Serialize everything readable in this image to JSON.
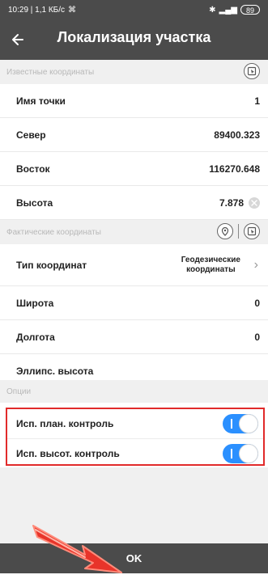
{
  "status_bar": {
    "time_info": "10:29 | 1,1 КБ/с",
    "battery": "89"
  },
  "header": {
    "title": "Локализация участка"
  },
  "sections": {
    "known": "Известные координаты",
    "actual": "Фактические координаты",
    "options": "Опции"
  },
  "known_rows": [
    {
      "label": "Имя точки",
      "value": "1"
    },
    {
      "label": "Север",
      "value": "89400.323"
    },
    {
      "label": "Восток",
      "value": "116270.648"
    },
    {
      "label": "Высота",
      "value": "7.878"
    }
  ],
  "actual_rows": {
    "type_label": "Тип координат",
    "type_value_line1": "Геодезические",
    "type_value_line2": "координаты",
    "latitude_label": "Широта",
    "latitude_value": "0",
    "longitude_label": "Долгота",
    "longitude_value": "0",
    "ellipsoid_label": "Эллипс. высота"
  },
  "options": [
    {
      "label": "Исп. план. контроль",
      "enabled": true
    },
    {
      "label": "Исп. высот. контроль",
      "enabled": true
    }
  ],
  "footer": {
    "ok_label": "OK"
  },
  "colors": {
    "header": "#4b4b4b",
    "toggle": "#2b90ff",
    "highlight": "#e12a2a",
    "section": "#f0f0f0"
  }
}
